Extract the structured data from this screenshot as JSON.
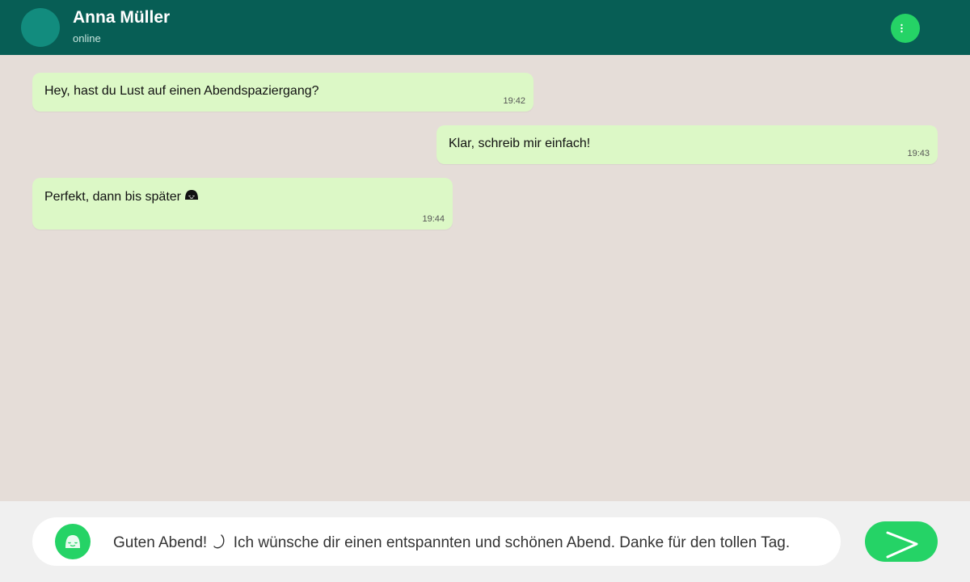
{
  "header": {
    "contact_name": "Anna Müller",
    "status": "online",
    "menu_icon": "more-vertical-icon"
  },
  "messages": [
    {
      "text": "Hey, hast du Lust auf einen Abendspaziergang?",
      "time": "19:42",
      "direction": "incoming"
    },
    {
      "text": "Klar, schreib mir einfach!",
      "time": "19:43",
      "direction": "outgoing"
    },
    {
      "text": "Perfekt, dann bis später",
      "time": "19:44",
      "direction": "incoming",
      "icon": "smiling-face-icon"
    }
  ],
  "composer": {
    "emoji_icon": "smiling-face-icon",
    "text_before_icon": "Guten Abend!",
    "inline_icon": "crescent-moon-icon",
    "text_after_icon": "Ich wünsche dir einen entspannten und schönen Abend. Danke für den tollen Tag.",
    "send_icon": "send-icon"
  },
  "colors": {
    "header": "#075e55",
    "accent": "#25d366",
    "bubble": "#dcf8c6",
    "chat_background": "#e5ddd8",
    "composer_background": "#f0f0f0"
  }
}
